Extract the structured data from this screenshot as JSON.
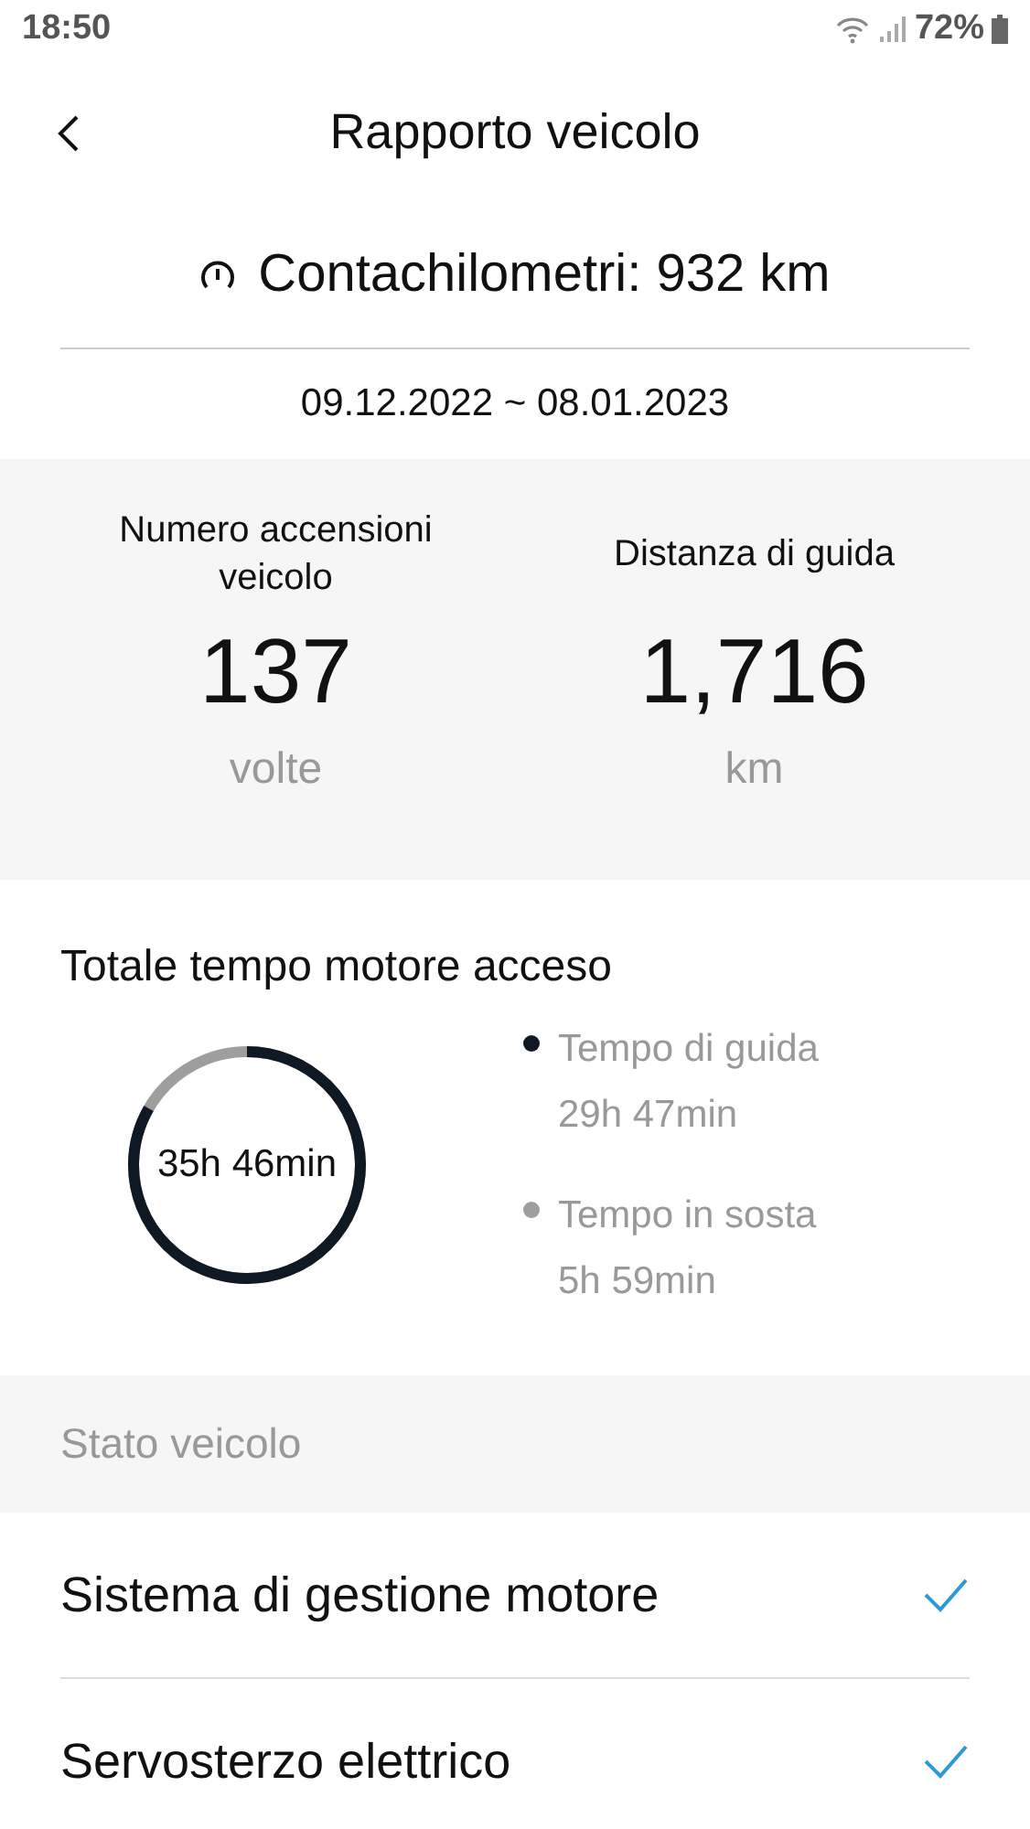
{
  "status_bar": {
    "time": "18:50",
    "battery": "72%"
  },
  "header": {
    "title": "Rapporto veicolo"
  },
  "odometer": {
    "label": "Contachilometri: 932 km"
  },
  "period": "09.12.2022 ~ 08.01.2023",
  "stats": [
    {
      "label": "Numero accensioni veicolo",
      "value": "137",
      "unit": "volte"
    },
    {
      "label": "Distanza di guida",
      "value": "1,716",
      "unit": "km"
    }
  ],
  "engine_time": {
    "title": "Totale tempo motore acceso",
    "total": "35h 46min",
    "level": 0.833,
    "legend": [
      {
        "label": "Tempo di guida",
        "value": "29h 47min",
        "color": "#0f1923"
      },
      {
        "label": "Tempo in sosta",
        "value": "5h 59min",
        "color": "#9e9e9e"
      }
    ]
  },
  "vehicle_status": {
    "title": "Stato veicolo",
    "items": [
      {
        "label": "Sistema di gestione motore",
        "checked": true
      },
      {
        "label": "Servosterzo elettrico",
        "checked": true
      }
    ]
  }
}
